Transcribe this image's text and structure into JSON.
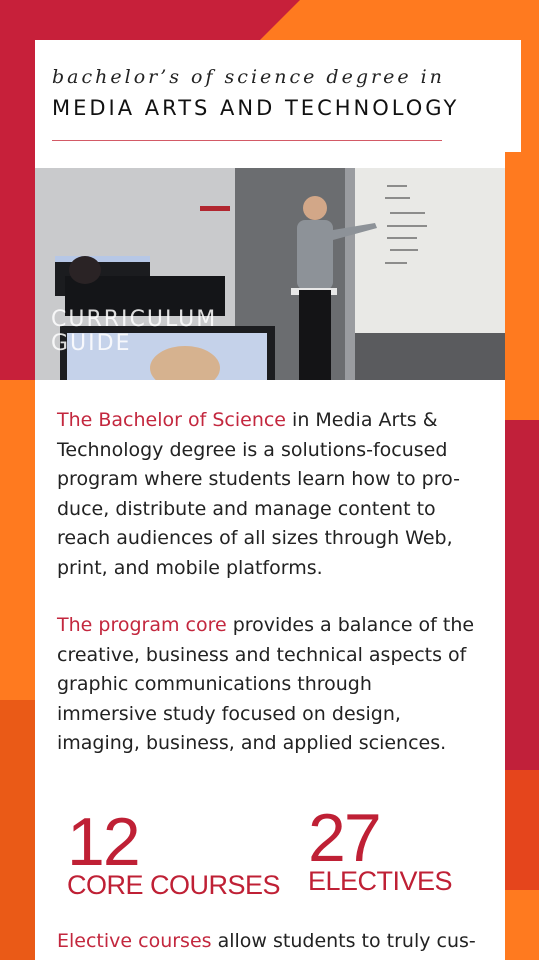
{
  "header": {
    "subtitle": "bachelor’s of science degree in",
    "title": "MEDIA ARTS AND TECHNOLOGY"
  },
  "hero": {
    "label": "CURRICULUM\nGUIDE"
  },
  "paragraphs": [
    {
      "accent": "The Bachelor of Science",
      "text": " in Media Arts & Technology degree is a solutions-focused program where students learn how to pro-duce, distribute and manage content to reach audiences of all sizes through Web, print, and mobile platforms."
    },
    {
      "accent": "The program core",
      "text": " provides a balance of the creative, business and technical aspects of graphic communications through immersive study focused on design, imaging, business, and applied sciences."
    },
    {
      "accent": "Elective courses",
      "text": " allow students to truly cus-"
    }
  ],
  "stats": [
    {
      "number": "12",
      "label": "CORE COURSES"
    },
    {
      "number": "27",
      "label": "ELECTIVES"
    }
  ],
  "colors": {
    "accent": "#c3273e",
    "orange": "#ff7a1f",
    "red": "#c7203a"
  }
}
